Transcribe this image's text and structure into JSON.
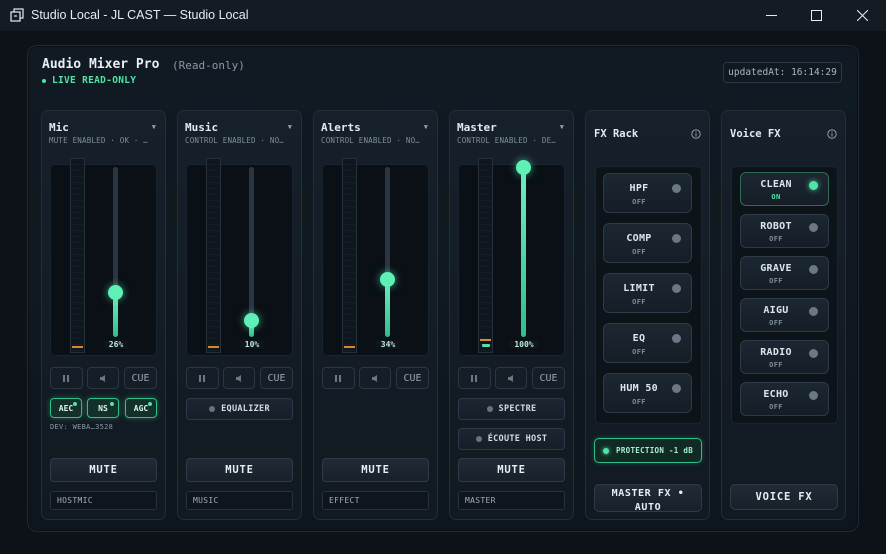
{
  "window": {
    "title": "Studio Local - JL CAST — Studio Local"
  },
  "header": {
    "title": "Audio Mixer Pro",
    "subtitle": "(Read-only)",
    "live_status": "LIVE READ-ONLY",
    "updated_at": "updatedAt: 16:14:29"
  },
  "channels": [
    {
      "name": "Mic",
      "status": "MUTE ENABLED · OK · …",
      "level_percent": 26,
      "level_label": "26%",
      "cue_label": "CUE",
      "processing": [
        "AEC",
        "NS",
        "AGC"
      ],
      "device": "DEV: WEBA…3528",
      "mute_label": "MUTE",
      "route": "HOSTMIC"
    },
    {
      "name": "Music",
      "status": "CONTROL ENABLED · NO…",
      "level_percent": 10,
      "level_label": "10%",
      "cue_label": "CUE",
      "equalizer_label": "EQUALIZER",
      "mute_label": "MUTE",
      "route": "MUSIC"
    },
    {
      "name": "Alerts",
      "status": "CONTROL ENABLED · NO…",
      "level_percent": 34,
      "level_label": "34%",
      "cue_label": "CUE",
      "mute_label": "MUTE",
      "route": "EFFECT"
    },
    {
      "name": "Master",
      "status": "CONTROL ENABLED · DE…",
      "level_percent": 100,
      "level_label": "100%",
      "cue_label": "CUE",
      "spectre_label": "SPECTRE",
      "ecoute_label": "ÉCOUTE HOST",
      "mute_label": "MUTE",
      "route": "MASTER"
    }
  ],
  "fx_rack": {
    "title": "FX Rack",
    "items": [
      {
        "label": "HPF",
        "state": "OFF"
      },
      {
        "label": "COMP",
        "state": "OFF"
      },
      {
        "label": "LIMIT",
        "state": "OFF"
      },
      {
        "label": "EQ",
        "state": "OFF"
      },
      {
        "label": "HUM 50",
        "state": "OFF"
      }
    ],
    "protection_label": "PROTECTION -1 dB",
    "master_fx_line1": "MASTER FX •",
    "master_fx_line2": "AUTO"
  },
  "voice_fx": {
    "title": "Voice FX",
    "items": [
      {
        "label": "CLEAN",
        "state": "ON"
      },
      {
        "label": "ROBOT",
        "state": "OFF"
      },
      {
        "label": "GRAVE",
        "state": "OFF"
      },
      {
        "label": "AIGU",
        "state": "OFF"
      },
      {
        "label": "RADIO",
        "state": "OFF"
      },
      {
        "label": "ECHO",
        "state": "OFF"
      }
    ],
    "button_label": "VOICE FX"
  },
  "colors": {
    "accent": "#4fe3a5",
    "peak": "#d98a2e",
    "background": "#0c1218"
  }
}
